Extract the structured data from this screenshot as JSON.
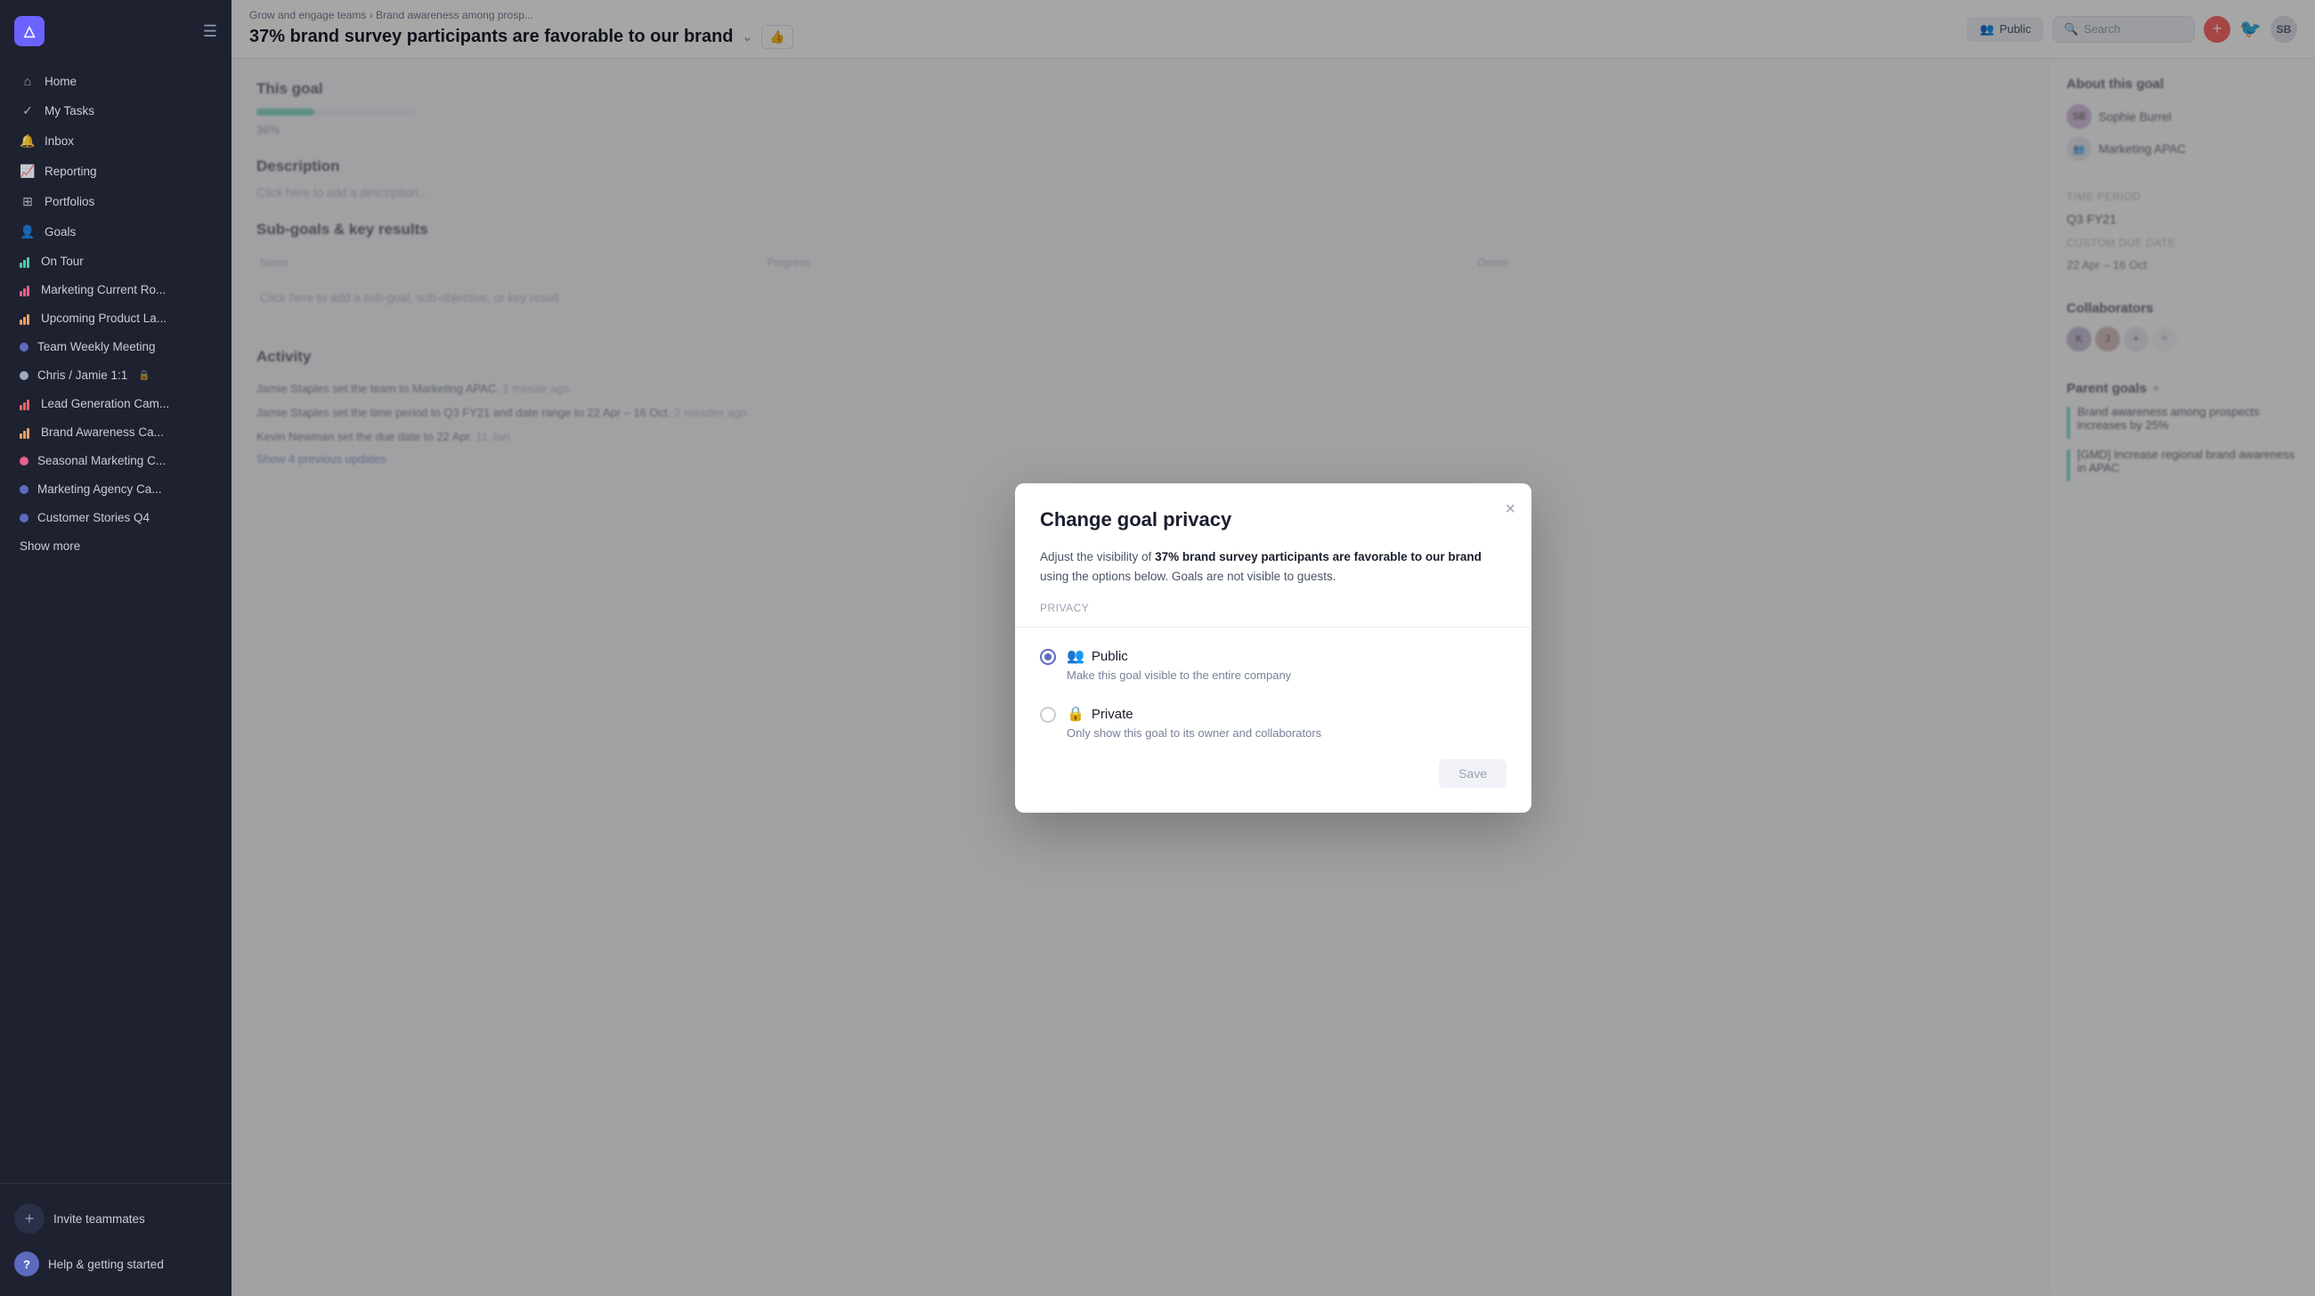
{
  "sidebar": {
    "logo_symbol": "△",
    "nav_items": [
      {
        "id": "home",
        "label": "Home",
        "icon": "⌂",
        "type": "icon"
      },
      {
        "id": "my-tasks",
        "label": "My Tasks",
        "icon": "✓",
        "type": "icon"
      },
      {
        "id": "inbox",
        "label": "Inbox",
        "icon": "🔔",
        "type": "icon"
      },
      {
        "id": "reporting",
        "label": "Reporting",
        "icon": "📈",
        "type": "icon"
      },
      {
        "id": "portfolios",
        "label": "Portfolios",
        "icon": "⊞",
        "type": "icon"
      },
      {
        "id": "goals",
        "label": "Goals",
        "icon": "👤",
        "type": "icon"
      },
      {
        "id": "on-tour",
        "label": "On Tour",
        "type": "bar",
        "color": "teal"
      },
      {
        "id": "marketing-current",
        "label": "Marketing Current Ro...",
        "type": "bar",
        "color": "pink"
      },
      {
        "id": "upcoming-product",
        "label": "Upcoming Product La...",
        "type": "bar",
        "color": "orange"
      },
      {
        "id": "team-weekly",
        "label": "Team Weekly Meeting",
        "type": "dot",
        "dotColor": "#5c6bc0"
      },
      {
        "id": "chris-jamie",
        "label": "Chris / Jamie 1:1",
        "type": "dot",
        "dotColor": "#a0a8c0",
        "locked": true
      },
      {
        "id": "lead-generation",
        "label": "Lead Generation Cam...",
        "type": "bar",
        "color": "red"
      },
      {
        "id": "brand-awareness",
        "label": "Brand Awareness Ca...",
        "type": "bar",
        "color": "orange"
      },
      {
        "id": "seasonal-marketing",
        "label": "Seasonal Marketing C...",
        "type": "dot",
        "dotColor": "#e8638c"
      },
      {
        "id": "marketing-agency",
        "label": "Marketing Agency Ca...",
        "type": "dot",
        "dotColor": "#5c6bc0"
      },
      {
        "id": "customer-stories",
        "label": "Customer Stories Q4",
        "type": "dot",
        "dotColor": "#5c6bc0"
      }
    ],
    "show_more": "Show more",
    "invite_teammates": "Invite teammates",
    "help": "Help & getting started"
  },
  "topbar": {
    "breadcrumb_part1": "Grow and engage teams",
    "breadcrumb_arrow": "›",
    "breadcrumb_part2": "Brand awareness among prosp...",
    "title": "37% brand survey participants are favorable to our brand",
    "public_label": "Public",
    "search_placeholder": "Search"
  },
  "main_content": {
    "this_section": "This goal",
    "progress_pct": 36,
    "progress_label": "36%",
    "description_title": "Des",
    "description_placeholder": "Click",
    "subgoals_title": "Sub",
    "col_name": "Name",
    "col_progress": "Progress",
    "col_owner": "Owner",
    "add_subgoal": "Click here to add a sub-goal, sub-objective, or key result",
    "activity_title": "Activity",
    "activities": [
      {
        "text": "Jamie Staples set the team to Marketing APAC.",
        "time": "1 minute ago"
      },
      {
        "text": "Jamie Staples set the time period to Q3 FY21 and date range to 22 Apr – 16 Oct.",
        "time": "2 minutes ago"
      },
      {
        "text": "Kevin Newman set the due date to 22 Apr.",
        "time": "11 Jan"
      }
    ],
    "show_previous": "Show 4 previous updates"
  },
  "right_panel": {
    "about_title": "About this goal",
    "owner_name": "Sophie Burrel",
    "team_name": "Marketing APAC",
    "time_period_label": "Time period",
    "time_period_value": "Q3 FY21",
    "due_date_label": "Custom due date",
    "due_date_value": "22 Apr – 16 Oct",
    "collaborators_label": "Collaborators",
    "parent_goals_label": "Parent goals",
    "parent_goal_1": "Brand awareness among prospects increases by 25%",
    "parent_goal_2": "[GMD] Increase regional brand awareness in APAC"
  },
  "modal": {
    "title": "Change goal privacy",
    "close_label": "×",
    "description_prefix": "Adjust the visibility of ",
    "description_bold": "37% brand survey participants are favorable to our brand",
    "description_suffix": " using the options below. Goals are not visible to guests.",
    "privacy_label": "Privacy",
    "option_public_label": "Public",
    "option_public_desc": "Make this goal visible to the entire company",
    "option_private_label": "Private",
    "option_private_desc": "Only show this goal to its owner and collaborators",
    "save_button": "Save",
    "selected_option": "public"
  }
}
